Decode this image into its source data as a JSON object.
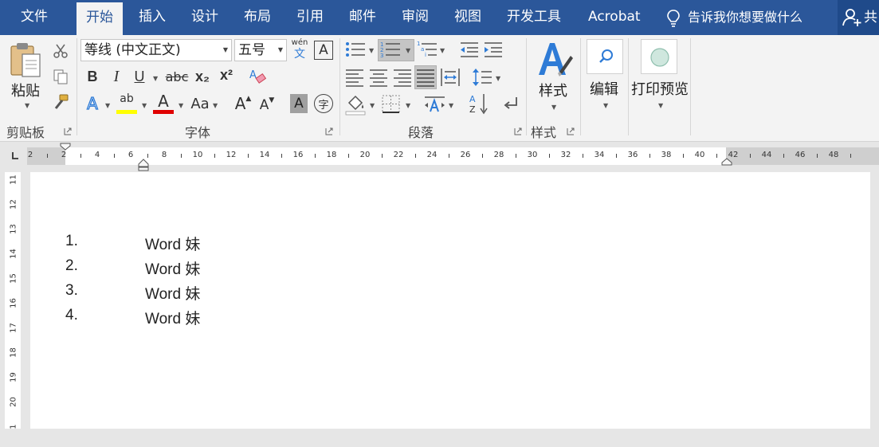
{
  "tabs": [
    {
      "label": "文件",
      "active": false
    },
    {
      "label": "开始",
      "active": true
    },
    {
      "label": "插入",
      "active": false
    },
    {
      "label": "设计",
      "active": false
    },
    {
      "label": "布局",
      "active": false
    },
    {
      "label": "引用",
      "active": false
    },
    {
      "label": "邮件",
      "active": false
    },
    {
      "label": "审阅",
      "active": false
    },
    {
      "label": "视图",
      "active": false
    },
    {
      "label": "开发工具",
      "active": false
    },
    {
      "label": "Acrobat",
      "active": false
    }
  ],
  "tell_me": "告诉我你想要做什么",
  "share_label": "共",
  "ribbon": {
    "clipboard": {
      "paste_label": "粘贴",
      "group_label": "剪贴板"
    },
    "font": {
      "font_name": "等线 (中文正文)",
      "font_size": "五号",
      "phonetic_top": "wén",
      "phonetic_bottom": "文",
      "border_char": "A",
      "bold": "B",
      "italic": "I",
      "underline": "U",
      "strike": "abc",
      "subscript": "x₂",
      "superscript": "x²",
      "text_effect": "A",
      "highlight": "ab",
      "font_color": "A",
      "change_case": "Aa",
      "grow": "A",
      "shrink": "A",
      "char_shading": "A",
      "enclose": "字",
      "group_label": "字体"
    },
    "paragraph": {
      "group_label": "段落"
    },
    "styles": {
      "label": "样式",
      "group_label": "样式"
    },
    "editing": {
      "label": "编辑"
    },
    "print_preview": {
      "label": "打印预览"
    }
  },
  "ruler": {
    "ticks": [
      "2",
      "2",
      "4",
      "6",
      "8",
      "10",
      "12",
      "14",
      "16",
      "18",
      "20",
      "22",
      "24",
      "26",
      "28",
      "30",
      "32",
      "34",
      "36",
      "38",
      "40",
      "42",
      "44",
      "46",
      "48"
    ],
    "vticks": [
      "11",
      "12",
      "13",
      "14",
      "15",
      "16",
      "17",
      "18",
      "19",
      "20",
      "1"
    ]
  },
  "document": {
    "list": [
      {
        "num": "1.",
        "text": "Word 妹"
      },
      {
        "num": "2.",
        "text": "Word 妹"
      },
      {
        "num": "3.",
        "text": "Word 妹"
      },
      {
        "num": "4.",
        "text": "Word 妹"
      }
    ]
  },
  "colors": {
    "titlebar": "#2b579a",
    "highlight_yellow": "#ffff00",
    "font_red": "#e00000",
    "text_effect_blue": "#2e7bd6"
  }
}
